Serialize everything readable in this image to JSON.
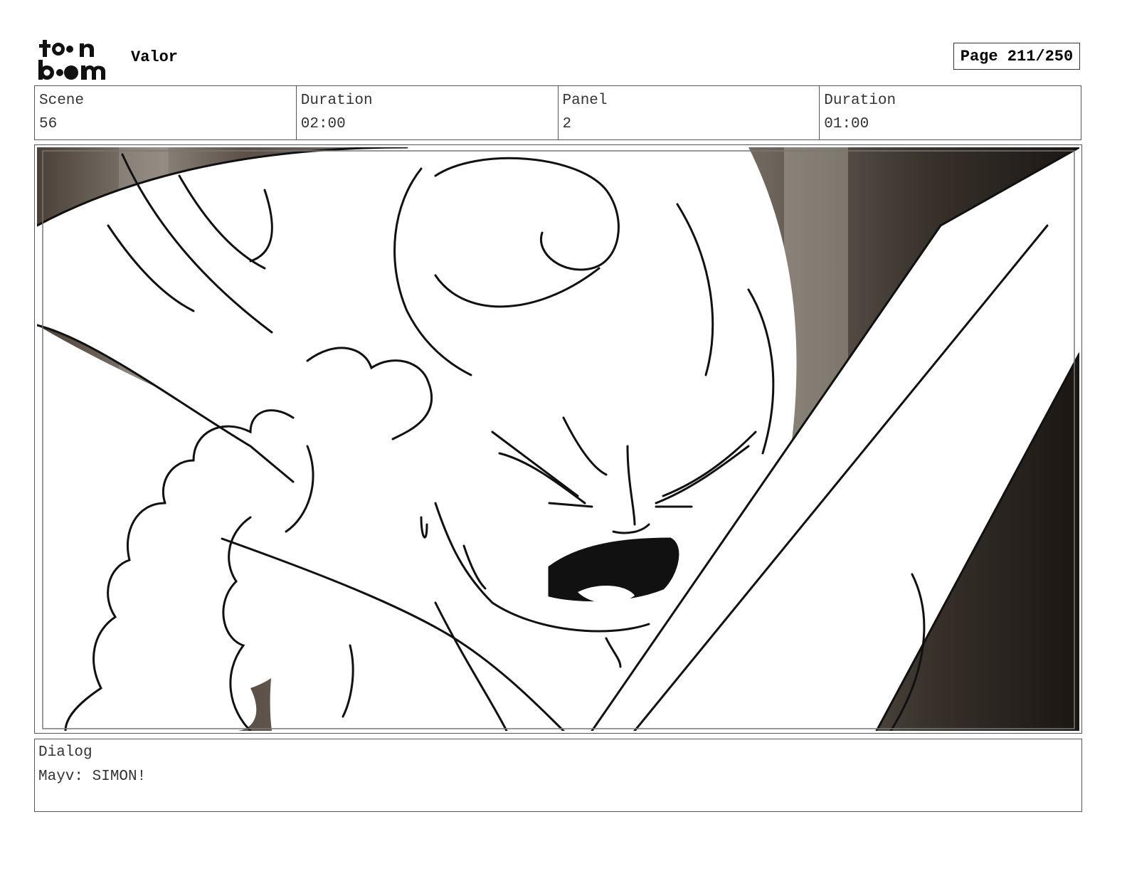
{
  "header": {
    "logo_text": "toon boom",
    "project_title": "Valor",
    "page_label": "Page 211/250"
  },
  "info": {
    "scene_label": "Scene",
    "scene_value": "56",
    "scene_duration_label": "Duration",
    "scene_duration_value": "02:00",
    "panel_label": "Panel",
    "panel_value": "2",
    "panel_duration_label": "Duration",
    "panel_duration_value": "01:00"
  },
  "panel": {
    "image_description_icon": "storyboard-sketch-image"
  },
  "dialog": {
    "label": "Dialog",
    "text": "Mayv: SIMON!"
  }
}
